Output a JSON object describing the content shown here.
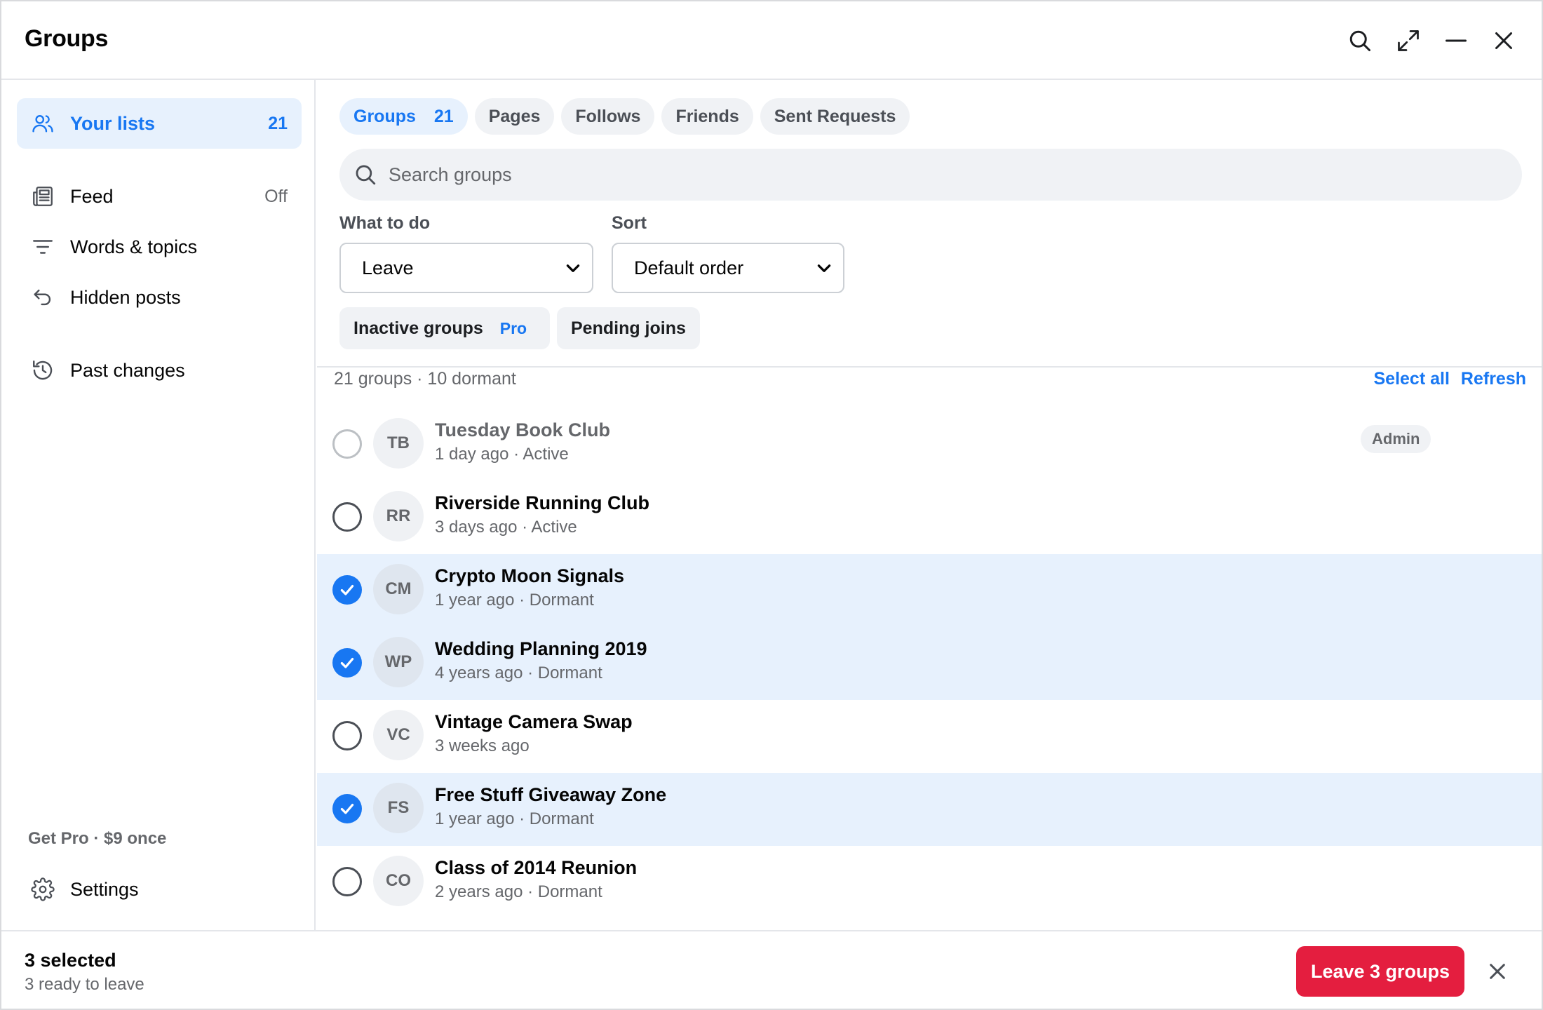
{
  "window": {
    "title": "Groups",
    "controls": [
      "search-icon",
      "expand-icon",
      "minimize-icon",
      "close-icon"
    ]
  },
  "sidebar": {
    "your_lists": {
      "label": "Your lists",
      "count": "21",
      "icon": "users-icon"
    },
    "items": [
      {
        "label": "Feed",
        "value": "Off",
        "icon": "newspaper-icon"
      },
      {
        "label": "Words & topics",
        "value": "",
        "icon": "filter-icon"
      },
      {
        "label": "Hidden posts",
        "value": "",
        "icon": "undo-icon"
      },
      {
        "label": "Past changes",
        "value": "",
        "icon": "history-icon"
      }
    ],
    "get_pro": "Get Pro · $9 once",
    "settings": {
      "label": "Settings",
      "icon": "gear-icon"
    }
  },
  "tabs": [
    {
      "label": "Groups",
      "count": "21",
      "active": true
    },
    {
      "label": "Pages"
    },
    {
      "label": "Follows"
    },
    {
      "label": "Friends"
    },
    {
      "label": "Sent Requests"
    }
  ],
  "search": {
    "placeholder": "Search groups",
    "value": ""
  },
  "controls": {
    "what_to_do": {
      "label": "What to do",
      "value": "Leave"
    },
    "sort": {
      "label": "Sort",
      "value": "Default order"
    }
  },
  "chips": {
    "inactive": {
      "label": "Inactive groups",
      "badge": "Pro"
    },
    "pending": {
      "label": "Pending joins"
    }
  },
  "list": {
    "summary": "21 groups · 10 dormant",
    "select_all": "Select all",
    "refresh": "Refresh",
    "rows": [
      {
        "initials": "TB",
        "name": "Tuesday Book Club",
        "meta": "1 day ago · Active",
        "selected": false,
        "dim": true,
        "badge": "Admin"
      },
      {
        "initials": "RR",
        "name": "Riverside Running Club",
        "meta": "3 days ago · Active",
        "selected": false
      },
      {
        "initials": "CM",
        "name": "Crypto Moon Signals",
        "meta": "1 year ago · Dormant",
        "selected": true
      },
      {
        "initials": "WP",
        "name": "Wedding Planning 2019",
        "meta": "4 years ago · Dormant",
        "selected": true
      },
      {
        "initials": "VC",
        "name": "Vintage Camera Swap",
        "meta": "3 weeks ago",
        "selected": false
      },
      {
        "initials": "FS",
        "name": "Free Stuff Giveaway Zone",
        "meta": "1 year ago · Dormant",
        "selected": true
      },
      {
        "initials": "CO",
        "name": "Class of 2014 Reunion",
        "meta": "2 years ago · Dormant",
        "selected": false
      }
    ]
  },
  "footer": {
    "selected": "3 selected",
    "ready": "3 ready to leave",
    "primary": "Leave 3 groups"
  },
  "colors": {
    "accent": "#1877f2",
    "danger": "#e41e3f",
    "selected_row": "#e7f1fd"
  }
}
